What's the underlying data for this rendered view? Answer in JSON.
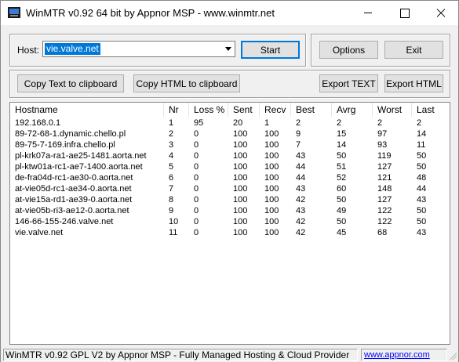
{
  "window": {
    "title": "WinMTR v0.92 64 bit by Appnor MSP - www.winmtr.net"
  },
  "host": {
    "label": "Host:",
    "value": "vie.valve.net"
  },
  "buttons": {
    "start": "Start",
    "options": "Options",
    "exit": "Exit",
    "copy_text": "Copy Text to clipboard",
    "copy_html": "Copy HTML to clipboard",
    "export_text": "Export TEXT",
    "export_html": "Export HTML"
  },
  "results": {
    "columns": [
      "Hostname",
      "Nr",
      "Loss %",
      "Sent",
      "Recv",
      "Best",
      "Avrg",
      "Worst",
      "Last"
    ],
    "rows": [
      [
        "192.168.0.1",
        "1",
        "95",
        "20",
        "1",
        "2",
        "2",
        "2",
        "2"
      ],
      [
        "89-72-68-1.dynamic.chello.pl",
        "2",
        "0",
        "100",
        "100",
        "9",
        "15",
        "97",
        "14"
      ],
      [
        "89-75-7-169.infra.chello.pl",
        "3",
        "0",
        "100",
        "100",
        "7",
        "14",
        "93",
        "11"
      ],
      [
        "pl-krk07a-ra1-ae25-1481.aorta.net",
        "4",
        "0",
        "100",
        "100",
        "43",
        "50",
        "119",
        "50"
      ],
      [
        "pl-ktw01a-rc1-ae7-1400.aorta.net",
        "5",
        "0",
        "100",
        "100",
        "44",
        "51",
        "127",
        "50"
      ],
      [
        "de-fra04d-rc1-ae30-0.aorta.net",
        "6",
        "0",
        "100",
        "100",
        "44",
        "52",
        "121",
        "48"
      ],
      [
        "at-vie05d-rc1-ae34-0.aorta.net",
        "7",
        "0",
        "100",
        "100",
        "43",
        "60",
        "148",
        "44"
      ],
      [
        "at-vie15a-rd1-ae39-0.aorta.net",
        "8",
        "0",
        "100",
        "100",
        "42",
        "50",
        "127",
        "43"
      ],
      [
        "at-vie05b-ri3-ae12-0.aorta.net",
        "9",
        "0",
        "100",
        "100",
        "43",
        "49",
        "122",
        "50"
      ],
      [
        "146-66-155-246.valve.net",
        "10",
        "0",
        "100",
        "100",
        "42",
        "50",
        "122",
        "50"
      ],
      [
        "vie.valve.net",
        "11",
        "0",
        "100",
        "100",
        "42",
        "45",
        "68",
        "43"
      ]
    ]
  },
  "statusbar": {
    "text": "WinMTR v0.92 GPL V2 by Appnor MSP - Fully Managed Hosting & Cloud Provider",
    "link": "www.appnor.com"
  },
  "colors": {
    "selection": "#0078d7",
    "link": "#0000ff"
  }
}
